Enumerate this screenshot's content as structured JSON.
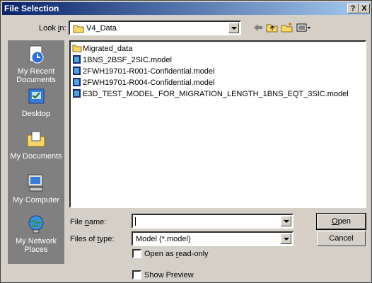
{
  "title": "File Selection",
  "title_buttons": {
    "help": "?",
    "close": "X"
  },
  "look_in": {
    "label_prefix": "Look ",
    "label_key": "i",
    "label_suffix": "n:",
    "value": "V4_Data"
  },
  "places": [
    {
      "label_line1": "My Recent",
      "label_line2": "Documents",
      "icon": "recent-documents-icon"
    },
    {
      "label_line1": "Desktop",
      "label_line2": "",
      "icon": "desktop-icon"
    },
    {
      "label_line1": "My Documents",
      "label_line2": "",
      "icon": "my-documents-icon"
    },
    {
      "label_line1": "My Computer",
      "label_line2": "",
      "icon": "my-computer-icon"
    },
    {
      "label_line1": "My Network",
      "label_line2": "Places",
      "icon": "my-network-places-icon"
    }
  ],
  "files": [
    {
      "name": "Migrated_data",
      "type": "folder"
    },
    {
      "name": "1BNS_2BSF_2SIC.model",
      "type": "model"
    },
    {
      "name": "2FWH19701-R001-Confidential.model",
      "type": "model"
    },
    {
      "name": "2FWH19701-R004-Confidential.model",
      "type": "model"
    },
    {
      "name": "E3D_TEST_MODEL_FOR_MIGRATION_LENGTH_1BNS_EQT_3SIC.model",
      "type": "model"
    }
  ],
  "file_name": {
    "label_prefix": "File ",
    "label_key": "n",
    "label_suffix": "ame:",
    "value": ""
  },
  "files_of_type": {
    "label_prefix": "Files of ",
    "label_key": "t",
    "label_suffix": "ype:",
    "value": "Model (*.model)"
  },
  "open_readonly": {
    "label_prefix": "Open as ",
    "label_key": "r",
    "label_suffix": "ead-only",
    "checked": false
  },
  "show_preview": {
    "label": "Show Preview",
    "checked": false
  },
  "buttons": {
    "open_key": "O",
    "open_rest": "pen",
    "cancel": "Cancel"
  }
}
